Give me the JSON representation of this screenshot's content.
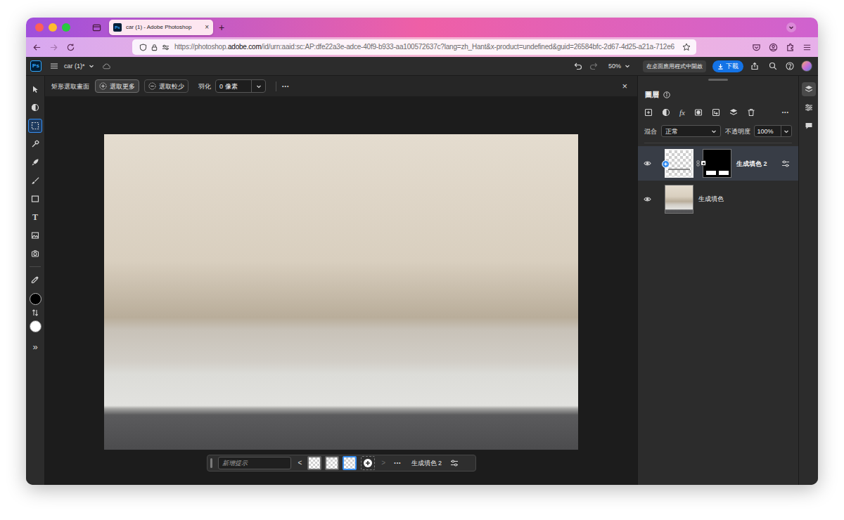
{
  "browser": {
    "tab": {
      "favicon": "Ps",
      "label": "car (1) - Adobe Photoshop",
      "close": "×",
      "selected": true
    },
    "new_tab": "+",
    "address": {
      "prefix": "https://photoshop.",
      "domain": "adobe.com",
      "rest": "/id/urn:aaid:sc:AP:dfe22a3e-adce-40f9-b933-aa100572637c?lang=zh_Hant&x-product=undefined&guid=26584bfc-2d67-4d25-a21a-712e6"
    },
    "forward_disabled": true
  },
  "app": {
    "logo": "Ps",
    "document": "car (1)*",
    "redo_disabled": true,
    "zoom": "50%",
    "open_desktop": "在桌面應用程式中開啟",
    "download": "下載"
  },
  "tools": [
    {
      "selected": false
    },
    {
      "selected": false
    },
    {
      "selected": true
    },
    {
      "selected": false
    },
    {
      "selected": false
    },
    {
      "selected": false
    },
    {
      "selected": false
    },
    {
      "selected": false,
      "glyph": "T"
    },
    {
      "selected": false
    },
    {
      "selected": false
    },
    {
      "selected": false
    }
  ],
  "colors": {
    "foreground": "#000000",
    "background": "#ffffff"
  },
  "more_tools": "»",
  "options_bar": {
    "tool": "矩形選取畫面",
    "modes": [
      {
        "label": "選取更多",
        "selected": true
      },
      {
        "label": "選取較少",
        "selected": false
      }
    ],
    "feather_label": "羽化",
    "feather_value": "0 像素",
    "more": "•••",
    "close": "×"
  },
  "task_bar": {
    "prompt_placeholder": "新增提示",
    "prev": "<",
    "variations": [
      {
        "selected": false
      },
      {
        "selected": false
      },
      {
        "selected": true
      }
    ],
    "next": {
      "label": ">",
      "disabled": true
    },
    "more": "•••",
    "layer": "生成填色 2"
  },
  "layers_panel": {
    "title": "圖層",
    "fx": "fx",
    "more": "•••",
    "blend_label": "混合",
    "blend_mode": "正常",
    "opacity_label": "不透明度",
    "opacity": "100%",
    "layers": [
      {
        "name": "生成填色 2",
        "selected": true,
        "visible": true
      },
      {
        "name": "生成填色",
        "selected": false,
        "visible": true
      }
    ]
  },
  "side_tabs": [
    {
      "selected": true
    },
    {
      "selected": false
    },
    {
      "selected": false
    }
  ]
}
